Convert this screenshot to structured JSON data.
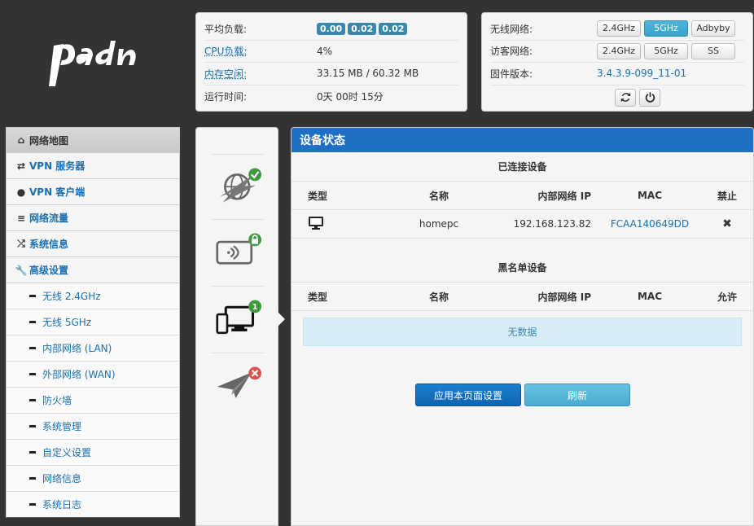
{
  "status": {
    "load_label": "平均负载:",
    "load_values": [
      "0.00",
      "0.02",
      "0.02"
    ],
    "cpu_label": "CPU负载:",
    "cpu_value": "4%",
    "mem_label": "内存空闲:",
    "mem_value": "33.15 MB / 60.32 MB",
    "uptime_label": "运行时间:",
    "uptime_value": "0天 00时 15分"
  },
  "wireless": {
    "wifi_label": "无线网络:",
    "wifi_buttons": [
      "2.4GHz",
      "5GHz",
      "Adbyby"
    ],
    "guest_label": "访客网络:",
    "guest_buttons": [
      "2.4GHz",
      "5GHz",
      "SS"
    ],
    "firmware_label": "固件版本:",
    "firmware_value": "3.4.3.9-099_11-01"
  },
  "sidebar": {
    "items": [
      {
        "label": "网络地图",
        "icon": "home-icon"
      },
      {
        "label": "VPN 服务器",
        "icon": "retweet-icon"
      },
      {
        "label": "VPN 客户端",
        "icon": "globe-icon"
      },
      {
        "label": "网络流量",
        "icon": "list-icon"
      },
      {
        "label": "系统信息",
        "icon": "random-icon"
      },
      {
        "label": "高级设置",
        "icon": "wrench-icon"
      }
    ],
    "subitems": [
      "无线 2.4GHz",
      "无线 5GHz",
      "内部网络 (LAN)",
      "外部网络 (WAN)",
      "防火墙",
      "系统管理",
      "自定义设置",
      "网络信息",
      "系统日志"
    ]
  },
  "mid": {
    "devices_count": "1"
  },
  "main": {
    "title": "设备状态",
    "connected_title": "已连接设备",
    "blacklist_title": "黑名单设备",
    "columns": [
      "类型",
      "名称",
      "内部网络 IP",
      "MAC",
      "禁止"
    ],
    "blacklist_columns": [
      "类型",
      "名称",
      "内部网络 IP",
      "MAC",
      "允许"
    ],
    "devices": [
      {
        "name": "homepc",
        "ip": "192.168.123.82",
        "mac": "FCAA140649DD"
      }
    ],
    "no_data": "无数据",
    "apply_label": "应用本页面设置",
    "refresh_label": "刷新"
  },
  "colors": {
    "header_blue": "#1f6fc4",
    "badge_blue": "#3a87ad",
    "active_button": "#3aa3c9",
    "ok_green": "#3d9a3d",
    "error_red": "#d9534f"
  }
}
